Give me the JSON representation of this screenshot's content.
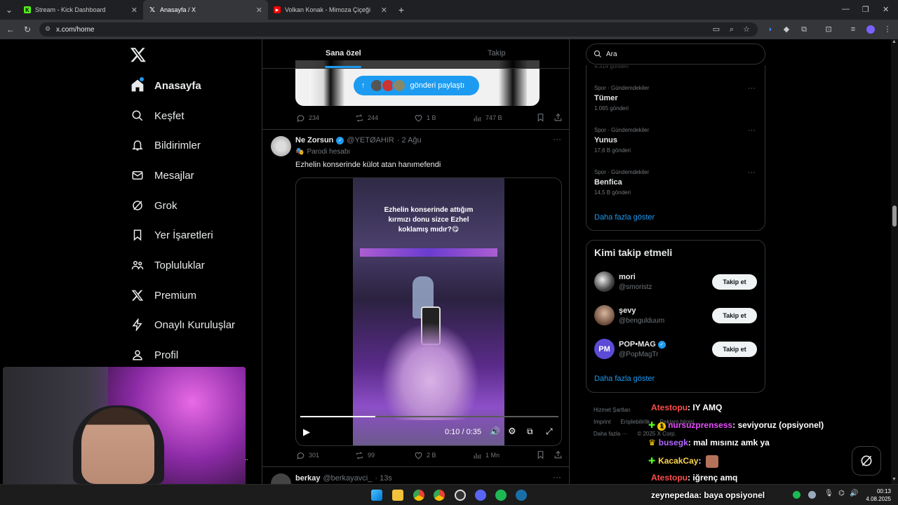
{
  "browser": {
    "tabs": [
      {
        "title": "Stream - Kick Dashboard",
        "favicon": "kick-icon",
        "color": "#53fc18",
        "active": false
      },
      {
        "title": "Anasayfa / X",
        "favicon": "x-logo-icon",
        "color": "#ffffff",
        "active": true
      },
      {
        "title": "Volkan Konak - Mimoza Çiçeği",
        "favicon": "youtube-icon",
        "color": "#ff0000",
        "active": false
      }
    ],
    "url": "x.com/home"
  },
  "sidebar": {
    "items": [
      {
        "label": "Anasayfa",
        "icon": "home-icon",
        "active": true
      },
      {
        "label": "Keşfet",
        "icon": "search-icon"
      },
      {
        "label": "Bildirimler",
        "icon": "bell-icon"
      },
      {
        "label": "Mesajlar",
        "icon": "mail-icon"
      },
      {
        "label": "Grok",
        "icon": "grok-icon"
      },
      {
        "label": "Yer İşaretleri",
        "icon": "bookmark-icon"
      },
      {
        "label": "Topluluklar",
        "icon": "communities-icon"
      },
      {
        "label": "Premium",
        "icon": "x-logo-icon"
      },
      {
        "label": "Onaylı Kuruluşlar",
        "icon": "lightning-icon"
      },
      {
        "label": "Profil",
        "icon": "person-icon"
      }
    ]
  },
  "feed": {
    "tabs": {
      "for_you": "Sana özel",
      "following": "Takip"
    },
    "share_pill": "gönderi paylaştı",
    "top_actions": {
      "replies": "234",
      "reposts": "244",
      "likes": "1 B",
      "views": "747 B"
    },
    "post": {
      "name": "Ne Zorsun",
      "handle": "@YETØAHIR",
      "date": "· 2 Ağu",
      "badge": "Parodi hesabı",
      "text": "Ezhelin konserinde külot atan hanımefendi",
      "video_caption": "Ezhelin konserinde attığım kırmızı donu sizce Ezhel koklamış mıdır?😋",
      "video_time": "0:10 / 0:35",
      "video_progress": 0.29,
      "actions": {
        "replies": "301",
        "reposts": "99",
        "likes": "2 B",
        "views": "1 Mn"
      }
    },
    "next_post": {
      "name": "berkay",
      "handle": "@berkayavci_",
      "time": "· 13s"
    }
  },
  "right": {
    "search_placeholder": "Ara",
    "partial_count": "4.314 gönderi",
    "trends": [
      {
        "category": "Spor · Gündemdekiler",
        "name": "Tümer",
        "count": "1.065 gönderi"
      },
      {
        "category": "Spor · Gündemdekiler",
        "name": "Yunus",
        "count": "17,6 B gönderi"
      },
      {
        "category": "Spor · Gündemdekiler",
        "name": "Benfica",
        "count": "14,5 B gönderi"
      }
    ],
    "show_more": "Daha fazla göster",
    "who_to_follow": {
      "title": "Kimi takip etmeli",
      "users": [
        {
          "name": "mori",
          "handle": "@smoristz",
          "verified": false
        },
        {
          "name": "şevy",
          "handle": "@bengulduum",
          "verified": false
        },
        {
          "name": "POP•MAG",
          "handle": "@PopMagTr",
          "verified": true
        }
      ],
      "follow_label": "Takip et",
      "show_more": "Daha fazla göster"
    },
    "footer": {
      "terms": "Hizmet Şartları",
      "imprint": "Imprint",
      "accessibility": "Erişilebilirlik",
      "ads": "Reklam bilgisi",
      "more": "Daha fazla ···",
      "copyright": "© 2025 X Corp."
    }
  },
  "chat": [
    {
      "user": "Atestopu",
      "color": "#ff4d4d",
      "message": ": IY AMQ"
    },
    {
      "user": "nursuzprensess",
      "color": "#e84dff",
      "message": ": seviyoruz (opsiyonel)"
    },
    {
      "user": "busegk",
      "color": "#b266ff",
      "message": ": mal mısınız amk ya"
    },
    {
      "user": "KacakCay",
      "color": "#ffd54d",
      "message": ":"
    },
    {
      "user": "Atestopu",
      "color": "#ff4d4d",
      "message": ": iğrenç amq"
    },
    {
      "user": "zeynepedaa",
      "color": "#ffffff",
      "message": ": baya opsiyonel"
    }
  ],
  "taskbar": {
    "time": "00:13",
    "date": "4.08.2025"
  }
}
